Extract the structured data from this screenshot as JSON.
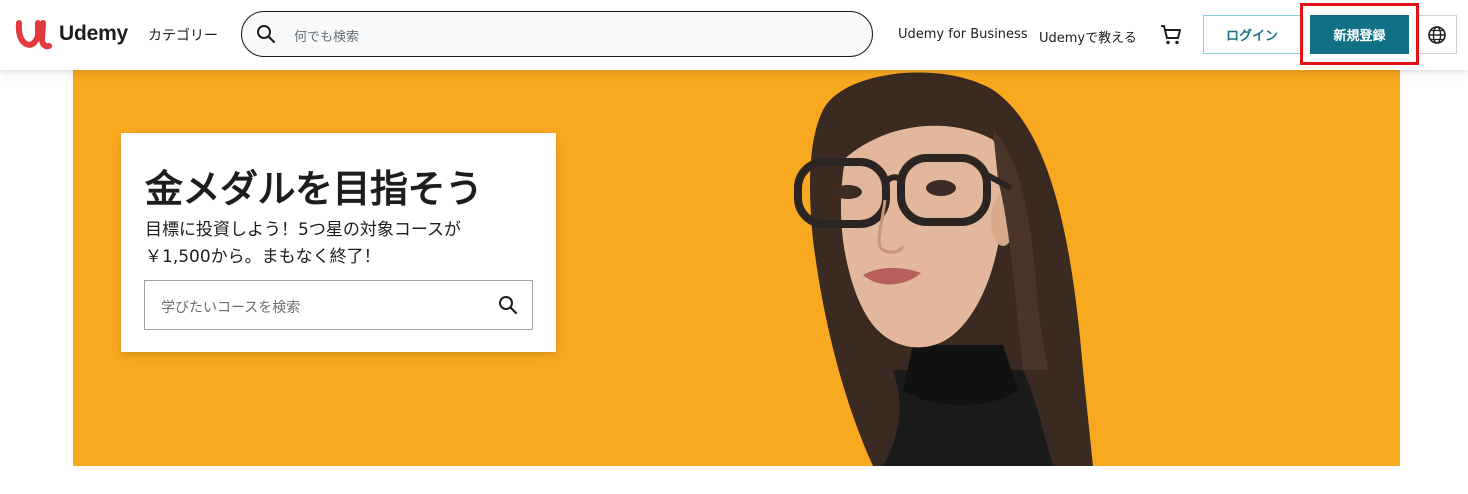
{
  "header": {
    "logo_text": "Udemy",
    "categories": "カテゴリー",
    "search_placeholder": "何でも検索",
    "business": "Udemy for Business",
    "teach": "Udemyで教える",
    "login": "ログイン",
    "signup": "新規登録"
  },
  "hero": {
    "title": "金メダルを目指そう",
    "subtitle_line1": "目標に投資しよう！5つ星の対象コースが",
    "subtitle_line2": "￥1,500から。まもなく終了！",
    "search_placeholder": "学びたいコースを検索"
  },
  "icons": [
    "udemy-logo-icon",
    "search-icon",
    "cart-icon",
    "globe-icon"
  ],
  "colors": {
    "hero_bg": "#f9a91f",
    "signup_bg": "#107186",
    "login_text": "#1b7285",
    "highlight": "#e11218"
  }
}
